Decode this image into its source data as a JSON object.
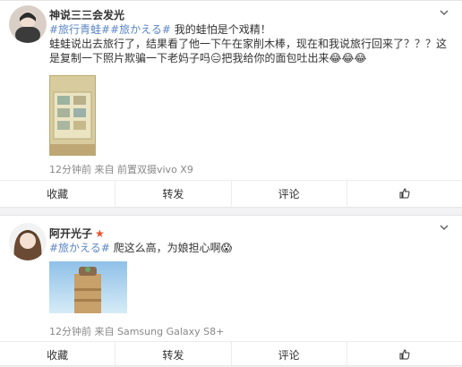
{
  "posts": [
    {
      "username": "神说三三会发光",
      "vip_badge": "",
      "text_parts": [
        {
          "tag": "#旅行青蛙#"
        },
        {
          "tag": "#旅かえる#"
        },
        {
          "text": " 我的蛙怕是个戏精！"
        }
      ],
      "text_line2": "蛙蛙说出去旅行了，结果看了他一下午在家削木棒，现在和我说旅行回来了？？？这是复制一下照片欺骗一下老妈子吗😑把我给你的面包吐出来😂😂😂",
      "meta": "12分钟前 来自 前置双摄vivo X9",
      "actions": [
        "收藏",
        "转发",
        "评论",
        ""
      ]
    },
    {
      "username": "阿开光子",
      "vip_badge": "★",
      "text_parts": [
        {
          "tag": "#旅かえる#"
        },
        {
          "text": " 爬这么高，为娘担心啊😱"
        }
      ],
      "meta": "12分钟前 来自 Samsung Galaxy S8+",
      "actions": [
        "收藏",
        "转发",
        "评论",
        ""
      ]
    }
  ]
}
